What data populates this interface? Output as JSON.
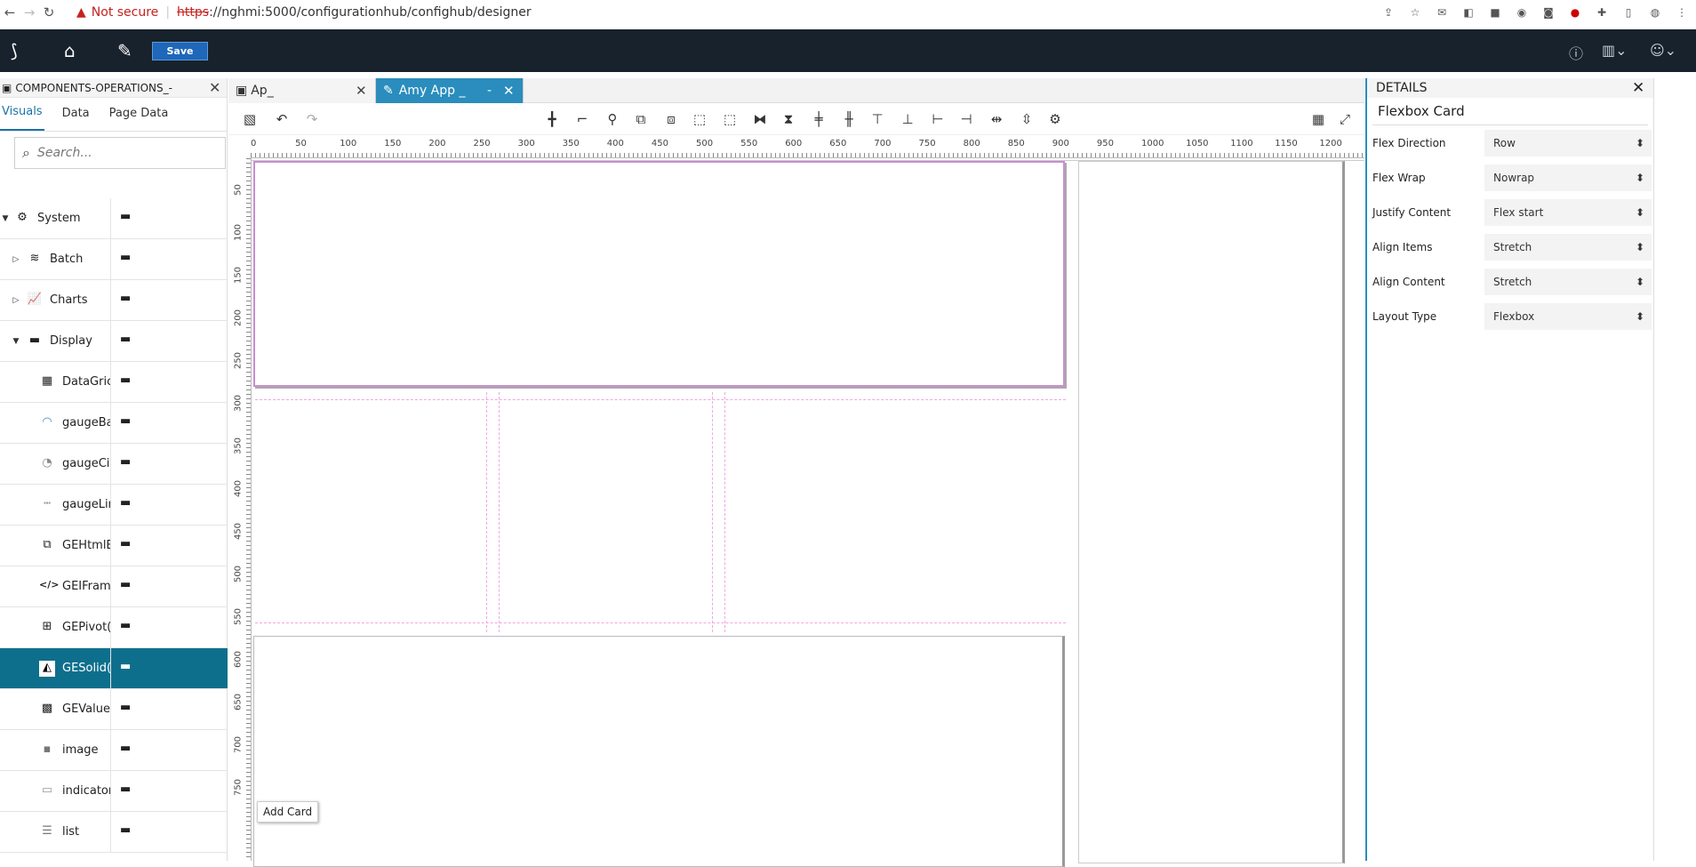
{
  "browser": {
    "security_label": "Not secure",
    "url_scheme": "https",
    "url_rest": "://nghmi:5000/configurationhub/confighub/designer"
  },
  "appbar": {
    "save_label": "Save"
  },
  "left_panel": {
    "title": "COMPONENTS-OPERATIONS_-",
    "tabs": [
      "Visuals",
      "Data",
      "Page Data"
    ],
    "search_placeholder": "Search...",
    "items": [
      {
        "label": "System",
        "expanded": true
      },
      {
        "label": "Batch",
        "expanded": false
      },
      {
        "label": "Charts",
        "expanded": false
      },
      {
        "label": "Display",
        "expanded": true
      },
      {
        "label": "DataGric"
      },
      {
        "label": "gaugeBa"
      },
      {
        "label": "gaugeCir"
      },
      {
        "label": "gaugeLir"
      },
      {
        "label": "GEHtmlE"
      },
      {
        "label": "GEIFram"
      },
      {
        "label": "GEPivot("
      },
      {
        "label": "GESolid(",
        "selected": true
      },
      {
        "label": "GEValue"
      },
      {
        "label": "image"
      },
      {
        "label": "indicator"
      },
      {
        "label": "list"
      }
    ]
  },
  "editor": {
    "tabs": [
      {
        "label": "Ap_"
      },
      {
        "label": "Amy App _",
        "active": true
      }
    ],
    "ruler_h": [
      "0",
      "50",
      "100",
      "150",
      "200",
      "250",
      "300",
      "350",
      "400",
      "450",
      "500",
      "550",
      "600",
      "650",
      "700",
      "750",
      "800",
      "850",
      "900",
      "950",
      "1000",
      "1050",
      "1100",
      "1150",
      "1200"
    ],
    "ruler_v": [
      "50",
      "100",
      "150",
      "200",
      "250",
      "300",
      "350",
      "400",
      "450",
      "500",
      "550",
      "600",
      "650",
      "700",
      "750"
    ],
    "add_card_label": "Add Card"
  },
  "details": {
    "header": "DETAILS",
    "title": "Flexbox Card",
    "props": [
      {
        "label": "Flex Direction",
        "value": "Row"
      },
      {
        "label": "Flex Wrap",
        "value": "Nowrap"
      },
      {
        "label": "Justify Content",
        "value": "Flex start"
      },
      {
        "label": "Align Items",
        "value": "Stretch"
      },
      {
        "label": "Align Content",
        "value": "Stretch"
      },
      {
        "label": "Layout Type",
        "value": "Flexbox"
      }
    ]
  },
  "colors": {
    "appbar": "#18222c",
    "accent": "#2a8dbd",
    "selected_row": "#0e6f8c",
    "save": "#1f67b8"
  }
}
